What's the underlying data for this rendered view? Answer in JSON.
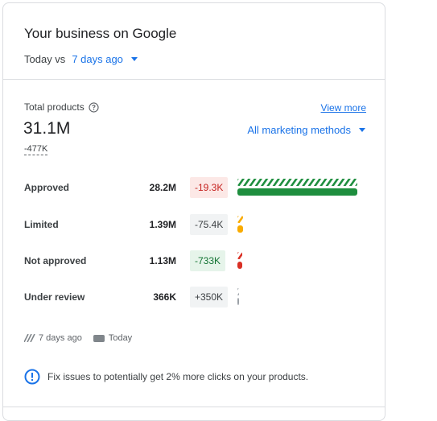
{
  "card": {
    "title": "Your business on Google",
    "compare_prefix": "Today vs",
    "compare_period": "7 days ago"
  },
  "summary": {
    "total_label": "Total products",
    "total_value": "31.1M",
    "total_delta": "-477K",
    "view_more": "View more",
    "methods_filter": "All marketing methods"
  },
  "rows": [
    {
      "label": "Approved",
      "value": "28.2M",
      "delta": "-19.3K",
      "delta_tone": "red",
      "color": "#1e8e3e",
      "share": 0.907
    },
    {
      "label": "Limited",
      "value": "1.39M",
      "delta": "-75.4K",
      "delta_tone": "neutral",
      "color": "#f9ab00",
      "share": 0.045
    },
    {
      "label": "Not approved",
      "value": "1.13M",
      "delta": "-733K",
      "delta_tone": "green",
      "color": "#d93025",
      "share": 0.036
    },
    {
      "label": "Under review",
      "value": "366K",
      "delta": "+350K",
      "delta_tone": "neutral",
      "color": "#9aa0a6",
      "share": 0.012
    }
  ],
  "legend": {
    "previous_label": "7 days ago",
    "current_label": "Today"
  },
  "info": {
    "message": "Fix issues to potentially get 2% more clicks on your products."
  },
  "colors": {
    "accent": "#1a73e8",
    "approved": "#1e8e3e",
    "limited": "#f9ab00",
    "not_approved": "#d93025",
    "under_review": "#9aa0a6"
  }
}
